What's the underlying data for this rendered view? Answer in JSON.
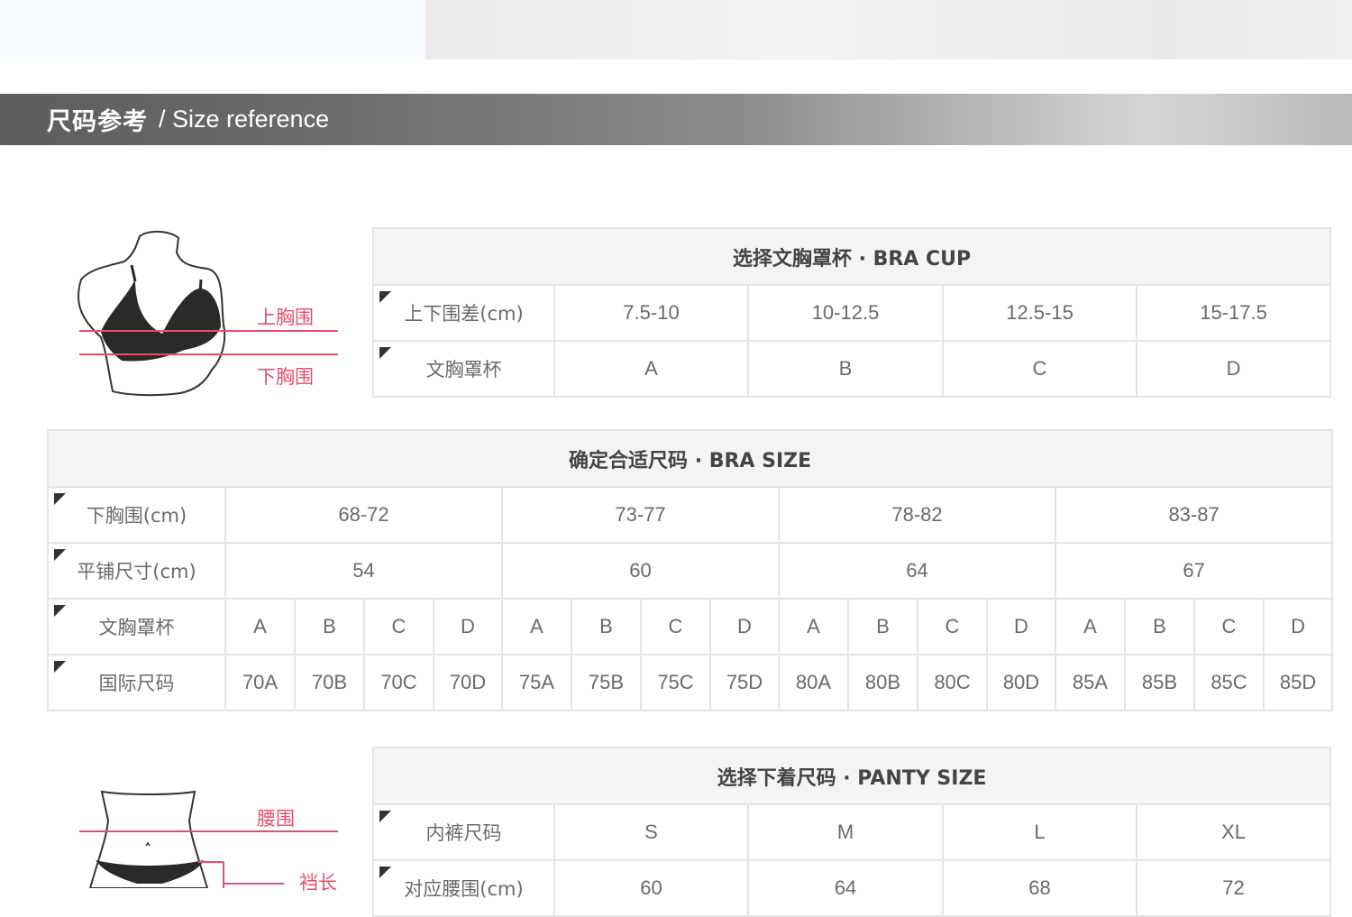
{
  "banner": {
    "title": "尺码参考",
    "subtitle": "/ Size reference"
  },
  "bra_cup": {
    "title": "选择文胸罩杯 · BRA CUP",
    "rows": [
      {
        "label": "上下围差(cm)",
        "cells": [
          "7.5-10",
          "10-12.5",
          "12.5-15",
          "15-17.5"
        ]
      },
      {
        "label": "文胸罩杯",
        "cells": [
          "A",
          "B",
          "C",
          "D"
        ]
      }
    ]
  },
  "bra_size": {
    "title": "确定合适尺码 · BRA SIZE",
    "underbust_label": "下胸围(cm)",
    "underbust": [
      "68-72",
      "73-77",
      "78-82",
      "83-87"
    ],
    "flat_label": "平铺尺寸(cm)",
    "flat": [
      "54",
      "60",
      "64",
      "67"
    ],
    "cup_label": "文胸罩杯",
    "cups": [
      "A",
      "B",
      "C",
      "D",
      "A",
      "B",
      "C",
      "D",
      "A",
      "B",
      "C",
      "D",
      "A",
      "B",
      "C",
      "D"
    ],
    "intl_label": "国际尺码",
    "intl": [
      "70A",
      "70B",
      "70C",
      "70D",
      "75A",
      "75B",
      "75C",
      "75D",
      "80A",
      "80B",
      "80C",
      "80D",
      "85A",
      "85B",
      "85C",
      "85D"
    ]
  },
  "panty_size": {
    "title": "选择下着尺码 · PANTY SIZE",
    "rows": [
      {
        "label": "内裤尺码",
        "cells": [
          "S",
          "M",
          "L",
          "XL"
        ]
      },
      {
        "label": "对应腰围(cm)",
        "cells": [
          "60",
          "64",
          "68",
          "72"
        ]
      }
    ]
  },
  "bust_figure": {
    "upper_label": "上胸围",
    "lower_label": "下胸围"
  },
  "panty_figure": {
    "waist_label": "腰围",
    "crotch_label": "裆长"
  },
  "colors": {
    "accent": "#e2506e",
    "border": "#e4e4e4",
    "header_bg": "#f4f4f4"
  }
}
